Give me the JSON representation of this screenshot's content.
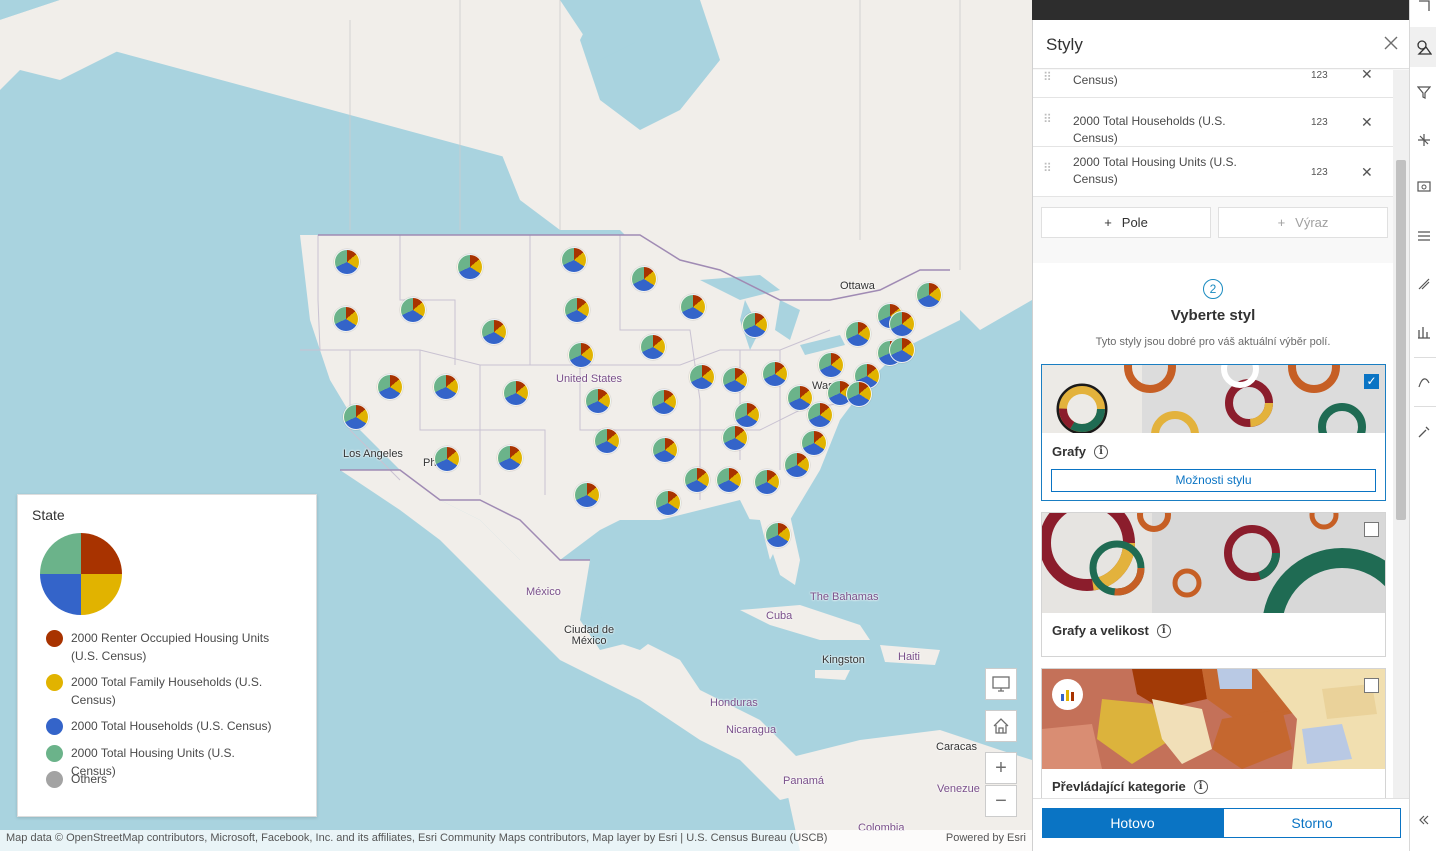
{
  "map": {
    "labels": {
      "ottawa": "Ottawa",
      "united_states": "United States",
      "washington": "Was",
      "los_angeles": "Los Angeles",
      "phoenix": "Ph",
      "mexico": "México",
      "mexico_city": "Ciudad de\nMéxico",
      "bahamas": "The Bahamas",
      "cuba": "Cuba",
      "kingston": "Kingston",
      "honduras": "Honduras",
      "nicaragua": "Nicaragua",
      "panama": "Panamá",
      "caracas": "Caracas",
      "venezuela": "Venezue",
      "colombia": "Colombia",
      "haiti": "Haiti"
    },
    "attribution": "Map data © OpenStreetMap contributors, Microsoft, Facebook, Inc. and its affiliates, Esri Community Maps contributors, Map layer by Esri | U.S. Census Bureau (USCB)",
    "powered_by": "Powered by Esri"
  },
  "legend": {
    "title": "State",
    "items": [
      {
        "label": "2000 Renter Occupied Housing Units (U.S. Census)",
        "color": "#a83300"
      },
      {
        "label": "2000 Total Family Households (U.S. Census)",
        "color": "#e1b300"
      },
      {
        "label": "2000 Total Households (U.S. Census)",
        "color": "#3464c9"
      },
      {
        "label": "2000 Total Housing Units (U.S. Census)",
        "color": "#6bb38a"
      },
      {
        "label": "Others",
        "color": "#a3a3a3"
      }
    ]
  },
  "panel": {
    "title": "Styly",
    "fields": [
      {
        "label": "Census)",
        "type_badge": "123"
      },
      {
        "label": "2000 Total Households (U.S. Census)",
        "type_badge": "123"
      },
      {
        "label": "2000 Total Housing Units (U.S. Census)",
        "type_badge": "123"
      }
    ],
    "add_field": "Pole",
    "add_expression": "Výraz",
    "step_number": "2",
    "step_title": "Vyberte styl",
    "step_subtitle": "Tyto styly jsou dobré pro váš aktuální výběr polí.",
    "styles": [
      {
        "name": "Grafy",
        "selected": true,
        "options_label": "Možnosti stylu"
      },
      {
        "name": "Grafy a velikost",
        "selected": false
      },
      {
        "name": "Převládající kategorie",
        "selected": false
      }
    ],
    "done": "Hotovo",
    "cancel": "Storno"
  },
  "colors": {
    "accent": "#0a74c4",
    "renter": "#a83300",
    "family": "#e1b300",
    "households": "#3464c9",
    "housing": "#6bb38a"
  }
}
